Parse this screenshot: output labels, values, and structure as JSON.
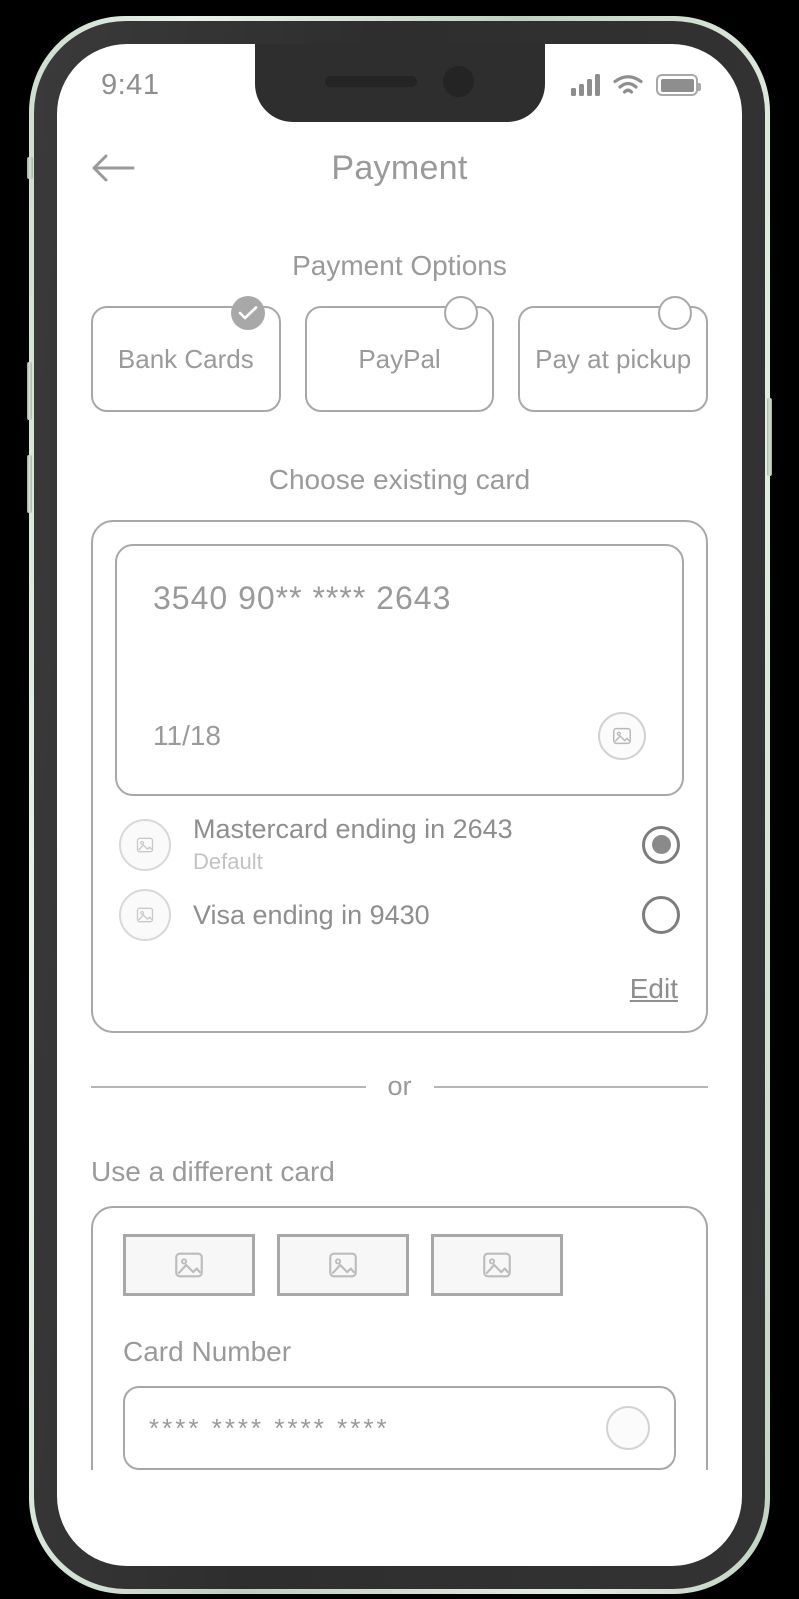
{
  "device": {
    "frame_color": "#cbdccd",
    "bezel_color": "#323232"
  },
  "status_bar": {
    "time": "9:41",
    "signal_icon": "signal-bars-icon",
    "wifi_icon": "wifi-icon",
    "battery_icon": "battery-icon"
  },
  "nav": {
    "back_icon": "back-arrow-icon",
    "title": "Payment"
  },
  "payment_options": {
    "heading": "Payment Options",
    "items": [
      {
        "label": "Bank Cards",
        "selected": true
      },
      {
        "label": "PayPal",
        "selected": false
      },
      {
        "label": "Pay at pickup",
        "selected": false
      }
    ]
  },
  "existing_card": {
    "heading": "Choose existing card",
    "card_preview": {
      "number": "3540  90**  ****  2643",
      "expiry": "11/18",
      "logo_icon": "image-placeholder-icon"
    },
    "saved_cards": [
      {
        "icon": "image-placeholder-icon",
        "title": "Mastercard ending in 2643",
        "subtitle": "Default",
        "selected": true
      },
      {
        "icon": "image-placeholder-icon",
        "title": "Visa ending in 9430",
        "subtitle": "",
        "selected": false
      }
    ],
    "edit_label": "Edit"
  },
  "divider": {
    "text": "or"
  },
  "new_card": {
    "heading": "Use a different card",
    "brand_tiles": [
      {
        "icon": "image-placeholder-icon"
      },
      {
        "icon": "image-placeholder-icon"
      },
      {
        "icon": "image-placeholder-icon"
      }
    ],
    "card_number_label": "Card Number",
    "card_number_value": "**** **** **** ****"
  },
  "colors": {
    "text_gray": "#9a9a9a",
    "border_gray": "#a8a8a8",
    "muted_gray": "#c2c2c2",
    "accent_fill": "#8a8a8a"
  }
}
